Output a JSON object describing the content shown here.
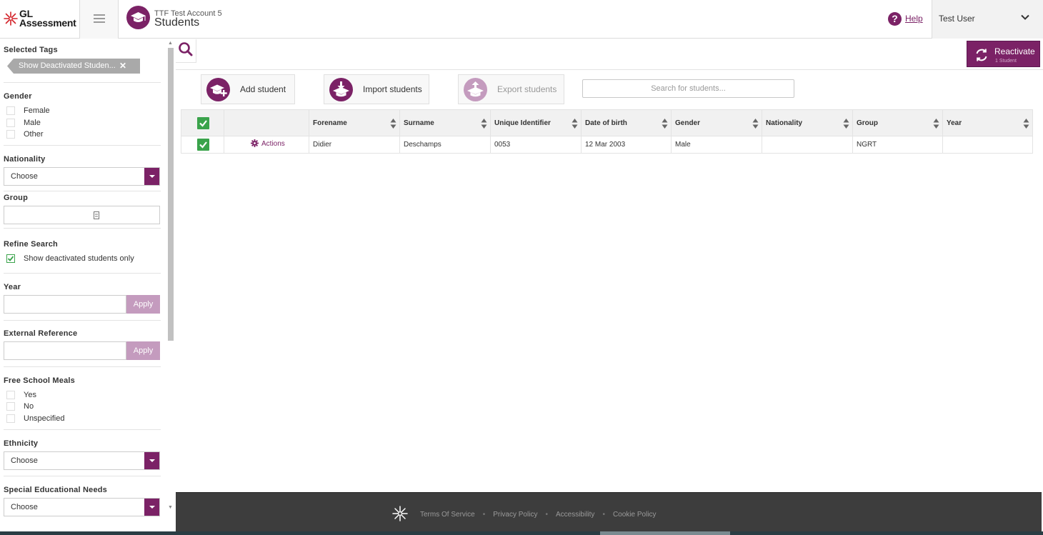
{
  "header": {
    "logo_line1": "GL",
    "logo_line2": "Assessment",
    "account_name": "TTF Test Account 5",
    "page_title": "Students",
    "help_label": "Help",
    "user_name": "Test User"
  },
  "sidebar": {
    "selected_tags_title": "Selected Tags",
    "tag_label": "Show Deactivated Studen...",
    "tag_remove": "✕",
    "gender": {
      "title": "Gender",
      "options": [
        {
          "label": "Female",
          "checked": false
        },
        {
          "label": "Male",
          "checked": false
        },
        {
          "label": "Other",
          "checked": false
        }
      ]
    },
    "nationality": {
      "title": "Nationality",
      "value": "Choose"
    },
    "group": {
      "title": "Group"
    },
    "refine": {
      "title": "Refine Search",
      "option_label": "Show deactivated students only",
      "checked": true
    },
    "year": {
      "title": "Year",
      "value": "",
      "apply_label": "Apply"
    },
    "external_reference": {
      "title": "External Reference",
      "value": "",
      "apply_label": "Apply"
    },
    "free_school_meals": {
      "title": "Free School Meals",
      "options": [
        {
          "label": "Yes",
          "checked": false
        },
        {
          "label": "No",
          "checked": false
        },
        {
          "label": "Unspecified",
          "checked": false
        }
      ]
    },
    "ethnicity": {
      "title": "Ethnicity",
      "value": "Choose"
    },
    "sen": {
      "title": "Special Educational Needs",
      "value": "Choose"
    }
  },
  "toolbar": {
    "reactivate_label": "Reactivate",
    "reactivate_sub": "1 Student",
    "add_student_label": "Add student",
    "import_students_label": "Import students",
    "export_students_label": "Export students",
    "search_placeholder": "Search for students..."
  },
  "table": {
    "columns": [
      "Forename",
      "Surname",
      "Unique Identifier",
      "Date of birth",
      "Gender",
      "Nationality",
      "Group",
      "Year"
    ],
    "actions_label": "Actions",
    "rows": [
      {
        "selected": true,
        "cells": [
          "Didier",
          "Deschamps",
          "0053",
          "12 Mar 2003",
          "Male",
          "",
          "NGRT",
          ""
        ]
      }
    ]
  },
  "footer": {
    "links": [
      "Terms Of Service",
      "Privacy Policy",
      "Accessibility",
      "Cookie Policy"
    ],
    "separator": "•"
  },
  "colors": {
    "brand": "#7b2266",
    "brand_light": "#c49bbe",
    "check_green": "#3aa34b",
    "footer_bg": "#3d3d3d"
  }
}
